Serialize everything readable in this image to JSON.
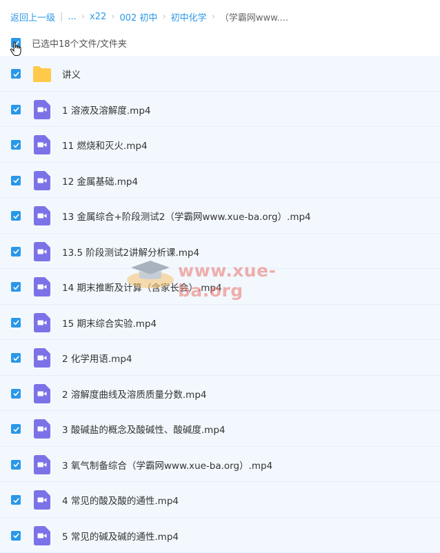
{
  "breadcrumb": {
    "back": "返回上一级",
    "ellipsis": "...",
    "items": [
      "x22",
      "002 初中",
      "初中化学"
    ],
    "current": "（学霸网www...."
  },
  "selection": {
    "text": "已选中18个文件/文件夹"
  },
  "files": [
    {
      "name": "讲义",
      "type": "folder"
    },
    {
      "name": "1 溶液及溶解度.mp4",
      "type": "video"
    },
    {
      "name": "11 燃烧和灭火.mp4",
      "type": "video"
    },
    {
      "name": "12 金属基础.mp4",
      "type": "video"
    },
    {
      "name": "13 金属综合+阶段测试2（学霸网www.xue-ba.org）.mp4",
      "type": "video"
    },
    {
      "name": "13.5 阶段测试2讲解分析课.mp4",
      "type": "video"
    },
    {
      "name": "14 期末推断及计算（含家长会）.mp4",
      "type": "video"
    },
    {
      "name": "15 期末综合实验.mp4",
      "type": "video"
    },
    {
      "name": "2 化学用语.mp4",
      "type": "video"
    },
    {
      "name": "2 溶解度曲线及溶质质量分数.mp4",
      "type": "video"
    },
    {
      "name": "3 酸碱盐的概念及酸碱性、酸碱度.mp4",
      "type": "video"
    },
    {
      "name": "3 氧气制备综合（学霸网www.xue-ba.org）.mp4",
      "type": "video"
    },
    {
      "name": "4 常见的酸及酸的通性.mp4",
      "type": "video"
    },
    {
      "name": "5 常见的碱及碱的通性.mp4",
      "type": "video"
    }
  ],
  "watermark": "www.xue-ba.org",
  "colors": {
    "accent": "#2a98e8",
    "folder": "#ffc94a",
    "video": "#7c72e8",
    "row_bg": "#f3f8fe"
  }
}
